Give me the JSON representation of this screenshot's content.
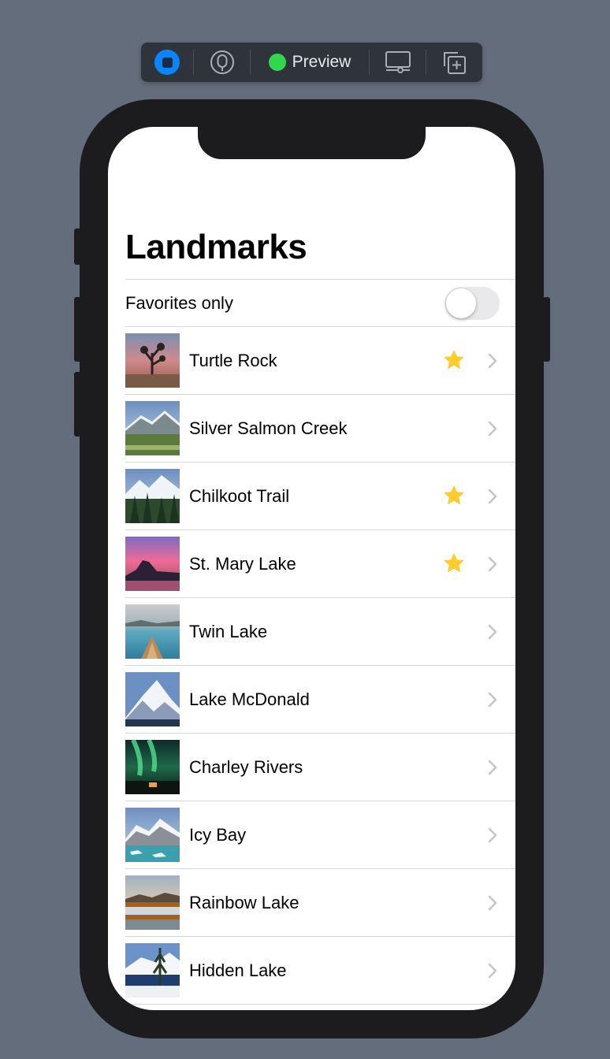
{
  "toolbar": {
    "preview_label": "Preview",
    "icons": {
      "live": "live-preview-icon",
      "inspect": "inspect-icon",
      "status": "status-dot-icon",
      "device": "device-settings-icon",
      "duplicate": "duplicate-preview-icon"
    }
  },
  "screen": {
    "title": "Landmarks",
    "favorites_toggle": {
      "label": "Favorites only",
      "on": false
    },
    "landmarks": [
      {
        "name": "Turtle Rock",
        "favorite": true,
        "thumb": "desert-sunset"
      },
      {
        "name": "Silver Salmon Creek",
        "favorite": false,
        "thumb": "snowy-meadow"
      },
      {
        "name": "Chilkoot Trail",
        "favorite": true,
        "thumb": "forest-mountains"
      },
      {
        "name": "St. Mary Lake",
        "favorite": true,
        "thumb": "pink-sky-lake"
      },
      {
        "name": "Twin Lake",
        "favorite": false,
        "thumb": "canoe-lake"
      },
      {
        "name": "Lake McDonald",
        "favorite": false,
        "thumb": "snow-peak"
      },
      {
        "name": "Charley Rivers",
        "favorite": false,
        "thumb": "aurora"
      },
      {
        "name": "Icy Bay",
        "favorite": false,
        "thumb": "glacier-bay"
      },
      {
        "name": "Rainbow Lake",
        "favorite": false,
        "thumb": "reflection-lake"
      },
      {
        "name": "Hidden Lake",
        "favorite": false,
        "thumb": "winter-lake"
      }
    ]
  },
  "colors": {
    "background": "#636d7b",
    "toolbar": "#2f343c",
    "accent_blue": "#0a84ff",
    "status_green": "#32d74b",
    "star_yellow": "#fdcc2d",
    "chevron": "#c4c4c7",
    "separator": "#d8d8dc"
  }
}
